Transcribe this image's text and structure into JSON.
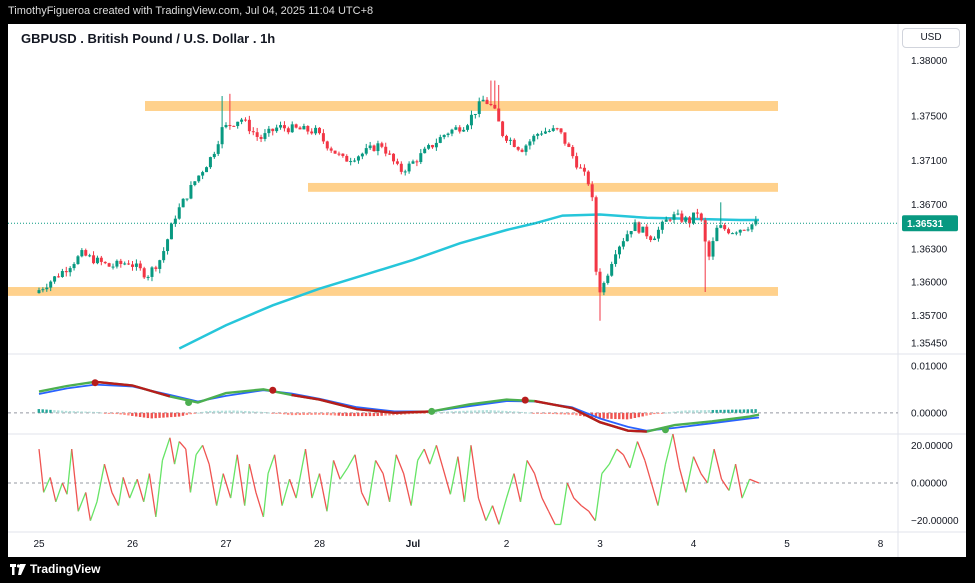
{
  "header": {
    "credit": "TimothyFigueroa created with TradingView.com, Jul 04, 2025 11:04 UTC+8"
  },
  "footer": {
    "brand": "TradingView",
    "brand_icon": "tradingview-logo-icon"
  },
  "currency_label": "USD",
  "chart_data": [
    {
      "type": "candlestick",
      "title": "GBPUSD . British Pound / U.S. Dollar . 1h",
      "price_scale": [
        "1.38000",
        "1.37500",
        "1.37100",
        "1.36700",
        "1.36300",
        "1.36000",
        "1.35700",
        "1.35450"
      ],
      "ylim": [
        1.3535,
        1.3815
      ],
      "last_price": "1.36531",
      "time_labels": [
        "25",
        "26",
        "27",
        "28",
        "Jul",
        "2",
        "3",
        "4",
        "5",
        "8"
      ],
      "zones": [
        {
          "from": 1.37545,
          "to": 1.37635
        },
        {
          "from": 1.36815,
          "to": 1.36895
        },
        {
          "from": 1.35875,
          "to": 1.35955
        }
      ],
      "moving_average_color": "#26c6da",
      "moving_average": [
        [
          1.5,
          1.354
        ],
        [
          2.0,
          1.3561
        ],
        [
          2.5,
          1.3579
        ],
        [
          3.0,
          1.3594
        ],
        [
          3.5,
          1.3607
        ],
        [
          4.0,
          1.362
        ],
        [
          4.5,
          1.3635
        ],
        [
          5.0,
          1.3647
        ],
        [
          5.3,
          1.3653
        ],
        [
          5.6,
          1.366
        ],
        [
          6.0,
          1.3661
        ],
        [
          6.5,
          1.3658
        ],
        [
          7.0,
          1.3657
        ],
        [
          7.5,
          1.3656
        ],
        [
          7.7,
          1.3656
        ]
      ],
      "close_path": [
        [
          0.0,
          1.359
        ],
        [
          0.3,
          1.361
        ],
        [
          0.5,
          1.3625
        ],
        [
          0.8,
          1.3614
        ],
        [
          1.0,
          1.3618
        ],
        [
          1.2,
          1.3606
        ],
        [
          1.35,
          1.3622
        ],
        [
          1.5,
          1.366
        ],
        [
          1.7,
          1.369
        ],
        [
          1.9,
          1.3715
        ],
        [
          2.0,
          1.3738
        ],
        [
          2.2,
          1.3748
        ],
        [
          2.4,
          1.3729
        ],
        [
          2.6,
          1.374
        ],
        [
          2.8,
          1.3738
        ],
        [
          3.0,
          1.3736
        ],
        [
          3.1,
          1.3726
        ],
        [
          3.3,
          1.371
        ],
        [
          3.5,
          1.3716
        ],
        [
          3.7,
          1.3725
        ],
        [
          3.9,
          1.37
        ],
        [
          4.0,
          1.3705
        ],
        [
          4.2,
          1.372
        ],
        [
          4.4,
          1.3735
        ],
        [
          4.6,
          1.3742
        ],
        [
          4.8,
          1.3765
        ],
        [
          4.9,
          1.3757
        ],
        [
          5.0,
          1.3734
        ],
        [
          5.2,
          1.372
        ],
        [
          5.4,
          1.3736
        ],
        [
          5.6,
          1.3737
        ],
        [
          5.8,
          1.3706
        ],
        [
          5.95,
          1.3686
        ],
        [
          6.0,
          1.361
        ],
        [
          6.05,
          1.359
        ],
        [
          6.2,
          1.3628
        ],
        [
          6.4,
          1.3652
        ],
        [
          6.6,
          1.364
        ],
        [
          6.8,
          1.366
        ],
        [
          7.0,
          1.3655
        ],
        [
          7.1,
          1.3665
        ],
        [
          7.2,
          1.362
        ],
        [
          7.3,
          1.365
        ],
        [
          7.45,
          1.3646
        ],
        [
          7.6,
          1.365
        ],
        [
          7.7,
          1.3653
        ]
      ],
      "spikes": [
        [
          1.95,
          1.3768
        ],
        [
          2.05,
          1.377
        ],
        [
          4.85,
          1.3782
        ],
        [
          4.9,
          1.3778
        ],
        [
          6.0,
          1.3565
        ],
        [
          7.12,
          1.3591
        ],
        [
          7.3,
          1.3672
        ]
      ]
    },
    {
      "type": "line",
      "name": "oscillator-1",
      "y_ticks": [
        "0.01000",
        "0.00000"
      ],
      "ylim": [
        -0.0045,
        0.0125
      ],
      "fast": [
        [
          0,
          0.0045
        ],
        [
          0.3,
          0.0057
        ],
        [
          0.6,
          0.0066
        ],
        [
          1.0,
          0.0058
        ],
        [
          1.4,
          0.0035
        ],
        [
          1.7,
          0.0022
        ],
        [
          2.0,
          0.0042
        ],
        [
          2.4,
          0.005
        ],
        [
          2.7,
          0.0038
        ],
        [
          3.0,
          0.0028
        ],
        [
          3.4,
          0.0008
        ],
        [
          3.8,
          0.0
        ],
        [
          4.2,
          0.0003
        ],
        [
          4.6,
          0.0018
        ],
        [
          5.0,
          0.0028
        ],
        [
          5.3,
          0.0025
        ],
        [
          5.7,
          0.001
        ],
        [
          6.0,
          -0.002
        ],
        [
          6.3,
          -0.0038
        ],
        [
          6.5,
          -0.004
        ],
        [
          6.8,
          -0.0026
        ],
        [
          7.2,
          -0.0018
        ],
        [
          7.6,
          -0.0008
        ],
        [
          7.7,
          -0.0004
        ]
      ],
      "slow": [
        [
          0,
          0.004
        ],
        [
          0.3,
          0.0052
        ],
        [
          0.6,
          0.006
        ],
        [
          1.0,
          0.0056
        ],
        [
          1.4,
          0.0038
        ],
        [
          1.7,
          0.0024
        ],
        [
          2.0,
          0.0036
        ],
        [
          2.4,
          0.0048
        ],
        [
          2.7,
          0.0041
        ],
        [
          3.0,
          0.003
        ],
        [
          3.4,
          0.0012
        ],
        [
          3.8,
          0.0003
        ],
        [
          4.2,
          0.0003
        ],
        [
          4.6,
          0.0014
        ],
        [
          5.0,
          0.0025
        ],
        [
          5.3,
          0.0024
        ],
        [
          5.7,
          0.0012
        ],
        [
          6.0,
          -0.0012
        ],
        [
          6.3,
          -0.003
        ],
        [
          6.5,
          -0.0038
        ],
        [
          6.8,
          -0.0032
        ],
        [
          7.2,
          -0.0022
        ],
        [
          7.6,
          -0.0012
        ],
        [
          7.7,
          -0.001
        ]
      ],
      "histogram": [
        [
          0,
          0.0008
        ],
        [
          0.3,
          0.0004
        ],
        [
          0.6,
          0.0002
        ],
        [
          0.9,
          -0.0004
        ],
        [
          1.2,
          -0.0012
        ],
        [
          1.5,
          -0.0008
        ],
        [
          1.8,
          0.0004
        ],
        [
          2.1,
          0.0005
        ],
        [
          2.4,
          0.0002
        ],
        [
          2.7,
          -0.0005
        ],
        [
          3.0,
          -0.0004
        ],
        [
          3.3,
          -0.0007
        ],
        [
          3.6,
          -0.0007
        ],
        [
          3.9,
          -0.0004
        ],
        [
          4.2,
          0.0001
        ],
        [
          4.5,
          0.0004
        ],
        [
          4.8,
          0.0006
        ],
        [
          5.1,
          0.0003
        ],
        [
          5.4,
          -0.0002
        ],
        [
          5.7,
          -0.0004
        ],
        [
          6.0,
          -0.0012
        ],
        [
          6.3,
          -0.0014
        ],
        [
          6.6,
          -0.0002
        ],
        [
          6.9,
          0.0005
        ],
        [
          7.2,
          0.0006
        ],
        [
          7.5,
          0.0007
        ],
        [
          7.7,
          0.0008
        ]
      ],
      "cross_markers": [
        [
          0.6,
          0.0064,
          "#b71c1c"
        ],
        [
          1.6,
          0.0022,
          "#4caf50"
        ],
        [
          2.5,
          0.0048,
          "#b71c1c"
        ],
        [
          4.2,
          0.0003,
          "#4caf50"
        ],
        [
          5.2,
          0.0027,
          "#b71c1c"
        ],
        [
          6.7,
          -0.0036,
          "#4caf50"
        ]
      ],
      "fast_color": "#4caf50",
      "slow_color": "#2962ff",
      "signal_color": "#b71c1c"
    },
    {
      "type": "line",
      "name": "oscillator-2",
      "y_ticks": [
        "20.00000",
        "0.00000",
        "−20.00000"
      ],
      "ylim": [
        -26,
        26
      ],
      "values": [
        [
          0,
          18
        ],
        [
          0.05,
          -5
        ],
        [
          0.12,
          3
        ],
        [
          0.18,
          -10
        ],
        [
          0.25,
          0
        ],
        [
          0.3,
          -6
        ],
        [
          0.35,
          18
        ],
        [
          0.42,
          -15
        ],
        [
          0.5,
          -5
        ],
        [
          0.55,
          -20
        ],
        [
          0.62,
          -10
        ],
        [
          0.7,
          10
        ],
        [
          0.78,
          -5
        ],
        [
          0.85,
          -12
        ],
        [
          0.9,
          3
        ],
        [
          0.97,
          -8
        ],
        [
          1.05,
          2
        ],
        [
          1.12,
          -10
        ],
        [
          1.18,
          5
        ],
        [
          1.25,
          -18
        ],
        [
          1.32,
          12
        ],
        [
          1.4,
          24
        ],
        [
          1.45,
          10
        ],
        [
          1.5,
          22
        ],
        [
          1.57,
          18
        ],
        [
          1.62,
          -5
        ],
        [
          1.68,
          15
        ],
        [
          1.75,
          20
        ],
        [
          1.82,
          10
        ],
        [
          1.9,
          -12
        ],
        [
          1.97,
          5
        ],
        [
          2.05,
          -8
        ],
        [
          2.12,
          15
        ],
        [
          2.2,
          -12
        ],
        [
          2.25,
          10
        ],
        [
          2.32,
          -5
        ],
        [
          2.4,
          -18
        ],
        [
          2.45,
          5
        ],
        [
          2.52,
          15
        ],
        [
          2.6,
          -12
        ],
        [
          2.68,
          2
        ],
        [
          2.75,
          -8
        ],
        [
          2.85,
          18
        ],
        [
          2.92,
          -8
        ],
        [
          3.0,
          5
        ],
        [
          3.08,
          -15
        ],
        [
          3.15,
          12
        ],
        [
          3.22,
          2
        ],
        [
          3.3,
          8
        ],
        [
          3.38,
          15
        ],
        [
          3.45,
          -5
        ],
        [
          3.52,
          -12
        ],
        [
          3.6,
          12
        ],
        [
          3.68,
          5
        ],
        [
          3.75,
          -10
        ],
        [
          3.82,
          15
        ],
        [
          3.9,
          5
        ],
        [
          3.98,
          -12
        ],
        [
          4.05,
          12
        ],
        [
          4.12,
          18
        ],
        [
          4.18,
          10
        ],
        [
          4.25,
          20
        ],
        [
          4.32,
          8
        ],
        [
          4.4,
          -6
        ],
        [
          4.48,
          14
        ],
        [
          4.55,
          -10
        ],
        [
          4.62,
          20
        ],
        [
          4.7,
          -8
        ],
        [
          4.78,
          -20
        ],
        [
          4.85,
          -12
        ],
        [
          4.92,
          -22
        ],
        [
          5.0,
          -8
        ],
        [
          5.08,
          5
        ],
        [
          5.15,
          -10
        ],
        [
          5.22,
          12
        ],
        [
          5.3,
          5
        ],
        [
          5.38,
          -8
        ],
        [
          5.45,
          -15
        ],
        [
          5.52,
          -22
        ],
        [
          5.58,
          -22
        ],
        [
          5.65,
          0
        ],
        [
          5.72,
          -8
        ],
        [
          5.8,
          -12
        ],
        [
          5.88,
          -15
        ],
        [
          5.95,
          -20
        ],
        [
          6.02,
          5
        ],
        [
          6.1,
          10
        ],
        [
          6.18,
          18
        ],
        [
          6.25,
          15
        ],
        [
          6.32,
          8
        ],
        [
          6.4,
          22
        ],
        [
          6.48,
          12
        ],
        [
          6.55,
          0
        ],
        [
          6.62,
          -12
        ],
        [
          6.7,
          10
        ],
        [
          6.78,
          26
        ],
        [
          6.85,
          8
        ],
        [
          6.92,
          -5
        ],
        [
          7.0,
          14
        ],
        [
          7.08,
          5
        ],
        [
          7.15,
          0
        ],
        [
          7.22,
          18
        ],
        [
          7.3,
          2
        ],
        [
          7.38,
          -4
        ],
        [
          7.45,
          10
        ],
        [
          7.52,
          -8
        ],
        [
          7.6,
          2
        ],
        [
          7.7,
          0
        ]
      ],
      "up_color": "#66e466",
      "down_color": "#ef5350"
    }
  ]
}
